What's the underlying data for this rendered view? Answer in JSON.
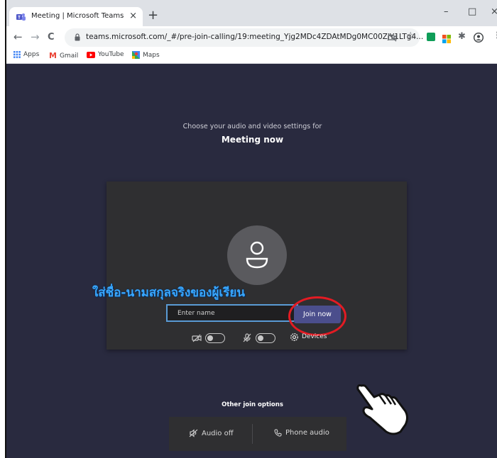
{
  "browser": {
    "tab_title": "Meeting | Microsoft Teams",
    "tab_close": "×",
    "new_tab": "+",
    "window_controls": {
      "minimize": "–",
      "maximize": "□",
      "close": "×"
    },
    "nav": {
      "back": "←",
      "forward": "→",
      "reload": "C"
    },
    "url": "teams.microsoft.com/_#/pre-join-calling/19:meeting_Yjg2MDc4ZDAtMDg0MC00ZjY1LTg4...",
    "bookmarks": [
      {
        "label": "Apps"
      },
      {
        "label": "Gmail"
      },
      {
        "label": "YouTube"
      },
      {
        "label": "Maps"
      }
    ]
  },
  "teams": {
    "choose_text": "Choose your audio and video settings for",
    "meeting_name": "Meeting now",
    "name_placeholder": "Enter name",
    "join_label": "Join now",
    "devices_label": "Devices",
    "other_options_title": "Other join options",
    "audio_off_label": "Audio off",
    "phone_audio_label": "Phone audio"
  },
  "annotation": {
    "text": "ใส่ชื่อ-นามสกุลจริงของผู้เรียน"
  },
  "colors": {
    "background": "#292a3f",
    "panel": "#2f2f31",
    "join_button": "#4b4e8c",
    "highlight_box": "#5a9bd5",
    "annotation_ring": "#e31b23",
    "annotation_text": "#38a7ff"
  }
}
